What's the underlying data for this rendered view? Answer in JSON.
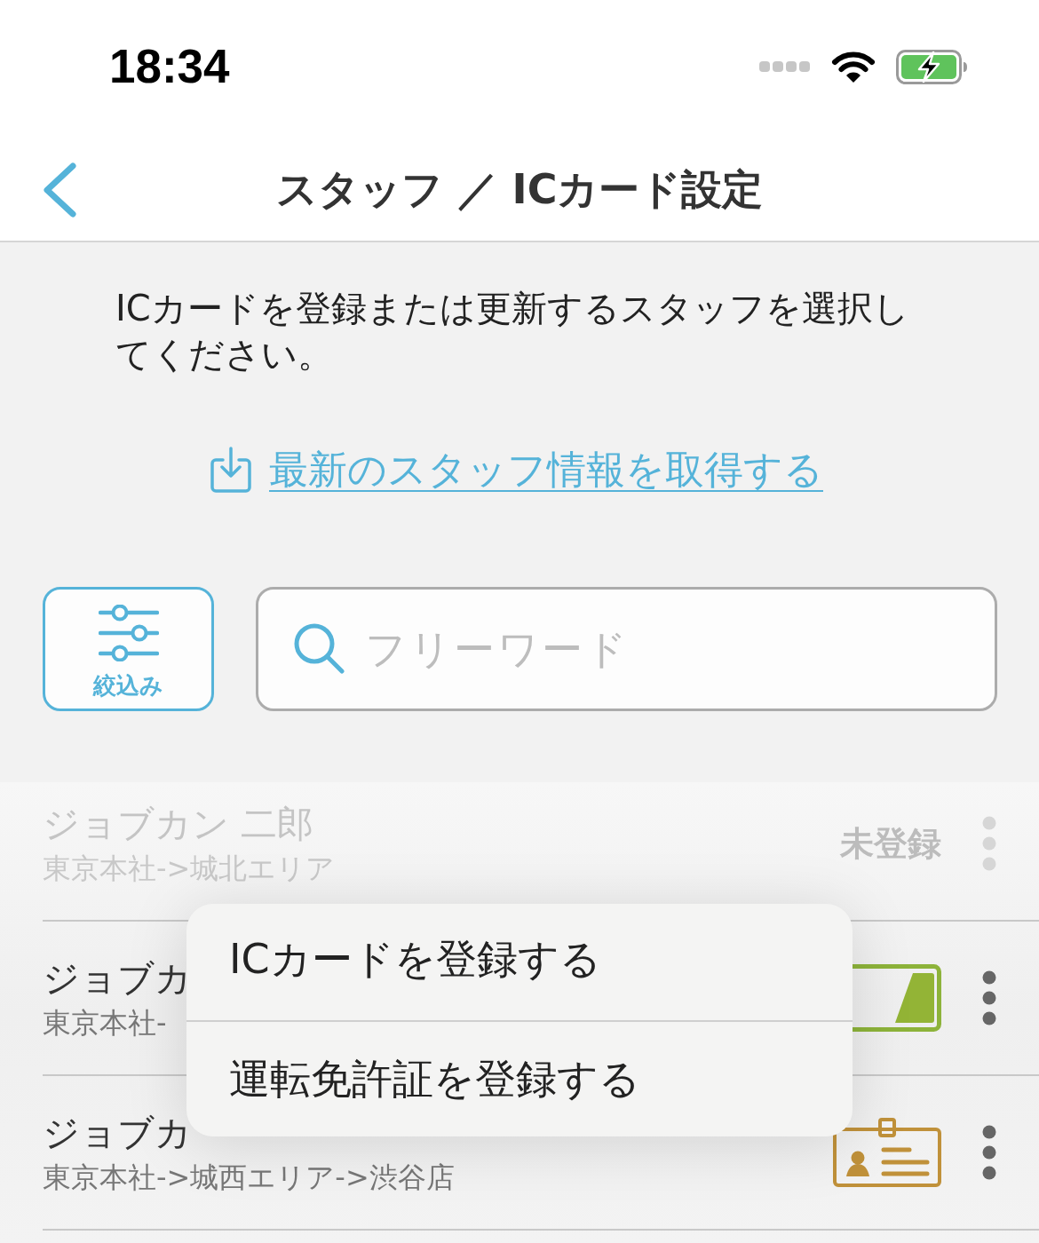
{
  "status_bar": {
    "time": "18:34"
  },
  "nav": {
    "title": "スタッフ ／ ICカード設定"
  },
  "instruction": "ICカードを登録または更新するスタッフを選択してください。",
  "refresh_link": {
    "label": "最新のスタッフ情報を取得する"
  },
  "filter_button": {
    "label": "絞込み"
  },
  "search": {
    "placeholder": "フリーワード"
  },
  "staff": [
    {
      "name": "ジョブカン 二郎",
      "path": "東京本社->城北エリア",
      "faded": true,
      "status": {
        "kind": "text",
        "label": "未登録"
      }
    },
    {
      "name": "ジョブカ",
      "path": "東京本社-",
      "faded": false,
      "status": {
        "kind": "ic_card"
      }
    },
    {
      "name": "ジョブカ",
      "path": "東京本社->城西エリア->渋谷店",
      "faded": false,
      "status": {
        "kind": "license"
      }
    }
  ],
  "menu": {
    "items": [
      {
        "label": "ICカードを登録する"
      },
      {
        "label": "運転免許証を登録する"
      }
    ]
  }
}
